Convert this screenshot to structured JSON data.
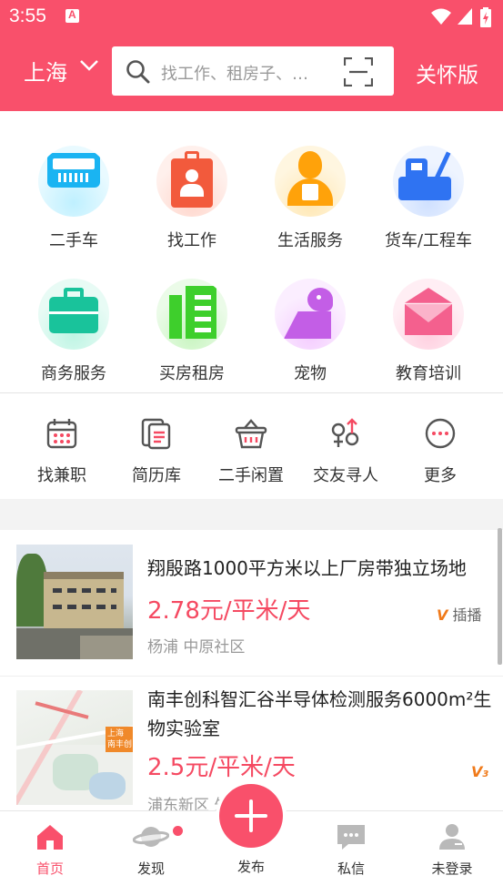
{
  "status_bar": {
    "time": "3:55"
  },
  "header": {
    "city": "上海",
    "search_placeholder": "找工作、租房子、…",
    "care_mode": "关怀版"
  },
  "categories": [
    {
      "label": "二手车",
      "icon": "car-icon"
    },
    {
      "label": "找工作",
      "icon": "briefcase-person-icon"
    },
    {
      "label": "生活服务",
      "icon": "service-person-icon"
    },
    {
      "label": "货车/工程车",
      "icon": "truck-icon"
    },
    {
      "label": "商务服务",
      "icon": "business-case-icon"
    },
    {
      "label": "买房租房",
      "icon": "building-icon"
    },
    {
      "label": "宠物",
      "icon": "pet-icon"
    },
    {
      "label": "教育培训",
      "icon": "education-icon"
    }
  ],
  "shortcuts": [
    {
      "label": "找兼职",
      "icon": "calendar-icon"
    },
    {
      "label": "简历库",
      "icon": "resume-icon"
    },
    {
      "label": "二手闲置",
      "icon": "basket-icon"
    },
    {
      "label": "交友寻人",
      "icon": "gender-icon"
    },
    {
      "label": "更多",
      "icon": "more-icon"
    }
  ],
  "listings": [
    {
      "title": "翔殷路1000平方米以上厂房带独立场地",
      "price": "2.78元/平米/天",
      "location": "杨浦 中原社区",
      "badge": "插播"
    },
    {
      "title": "南丰创科智汇谷半导体检测服务6000m²生物实验室",
      "price": "2.5元/平米/天",
      "location": "浦东新区 外高桥",
      "map_label": "上海\n南丰创"
    }
  ],
  "tabbar": {
    "home": "首页",
    "discover": "发现",
    "publish": "发布",
    "messages": "私信",
    "login": "未登录"
  },
  "colors": {
    "brand": "#f9506b",
    "price": "#f54a62"
  }
}
